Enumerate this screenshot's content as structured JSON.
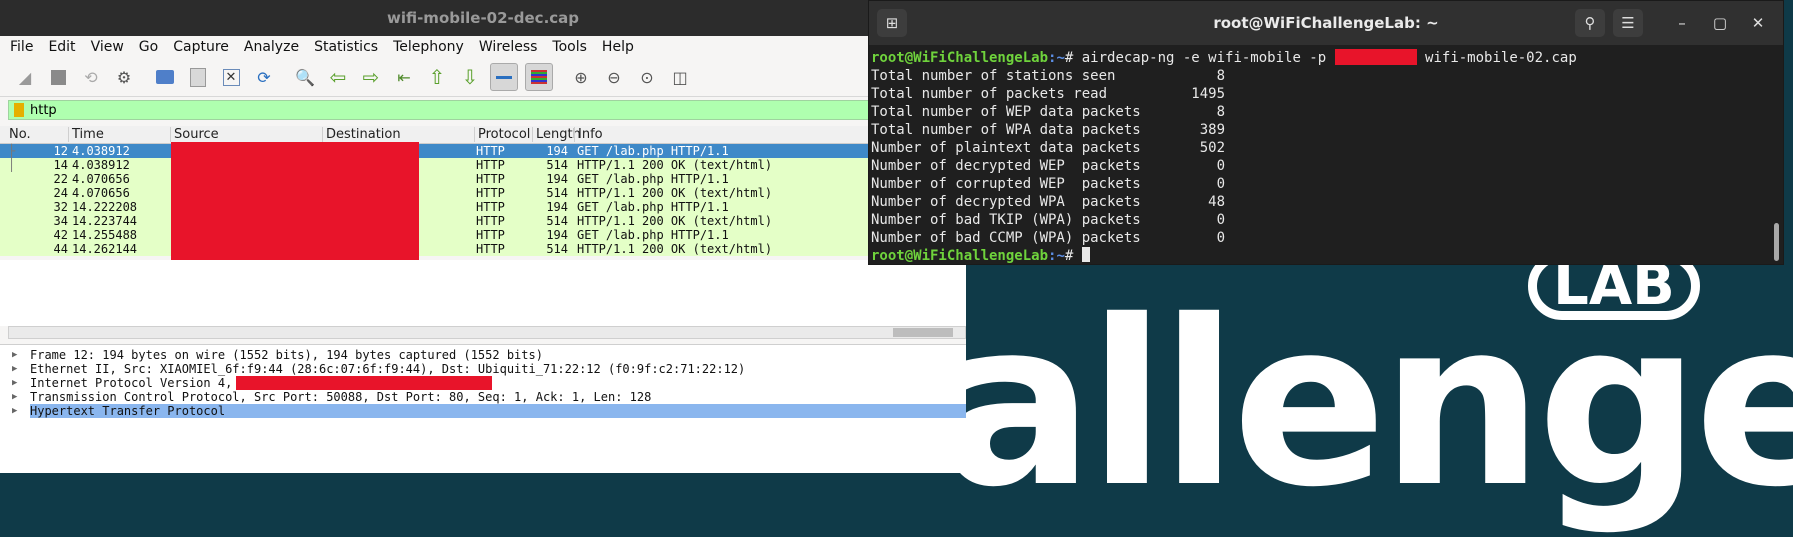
{
  "wireshark": {
    "window_title": "wifi-mobile-02-dec.cap",
    "menu": [
      "File",
      "Edit",
      "View",
      "Go",
      "Capture",
      "Analyze",
      "Statistics",
      "Telephony",
      "Wireless",
      "Tools",
      "Help"
    ],
    "filter_text": "http",
    "columns": [
      "No.",
      "Time",
      "Source",
      "Destination",
      "Protocol",
      "Length",
      "Info"
    ],
    "packets": [
      {
        "no": "12",
        "time": "4.038912",
        "protocol": "HTTP",
        "length": "194",
        "info": "GET /lab.php HTTP/1.1",
        "selected": true
      },
      {
        "no": "14",
        "time": "4.038912",
        "protocol": "HTTP",
        "length": "514",
        "info": "HTTP/1.1 200 OK  (text/html)"
      },
      {
        "no": "22",
        "time": "4.070656",
        "protocol": "HTTP",
        "length": "194",
        "info": "GET /lab.php HTTP/1.1"
      },
      {
        "no": "24",
        "time": "4.070656",
        "protocol": "HTTP",
        "length": "514",
        "info": "HTTP/1.1 200 OK  (text/html)"
      },
      {
        "no": "32",
        "time": "14.222208",
        "protocol": "HTTP",
        "length": "194",
        "info": "GET /lab.php HTTP/1.1"
      },
      {
        "no": "34",
        "time": "14.223744",
        "protocol": "HTTP",
        "length": "514",
        "info": "HTTP/1.1 200 OK  (text/html)"
      },
      {
        "no": "42",
        "time": "14.255488",
        "protocol": "HTTP",
        "length": "194",
        "info": "GET /lab.php HTTP/1.1"
      },
      {
        "no": "44",
        "time": "14.262144",
        "protocol": "HTTP",
        "length": "514",
        "info": "HTTP/1.1 200 OK  (text/html)"
      }
    ],
    "details": [
      "Frame 12: 194 bytes on wire (1552 bits), 194 bytes captured (1552 bits)",
      "Ethernet II, Src: XIAOMIEl_6f:f9:44 (28:6c:07:6f:f9:44), Dst: Ubiquiti_71:22:12 (f0:9f:c2:71:22:12)",
      "Internet Protocol Version 4,",
      "Transmission Control Protocol, Src Port: 50088, Dst Port: 80, Seq: 1, Ack: 1, Len: 128",
      "Hypertext Transfer Protocol"
    ]
  },
  "terminal": {
    "title": "root@WiFiChallengeLab: ~",
    "prompt_user": "root@WiFiChallengeLab",
    "prompt_path": ":~",
    "prompt_symbol": "# ",
    "command_before": "airdecap-ng -e wifi-mobile -p ",
    "command_after": " wifi-mobile-02.cap",
    "output": [
      "Total number of stations seen            8",
      "Total number of packets read          1495",
      "Total number of WEP data packets         8",
      "Total number of WPA data packets       389",
      "Number of plaintext data packets       502",
      "Number of decrypted WEP  packets         0",
      "Number of corrupted WEP  packets         0",
      "Number of decrypted WPA  packets        48",
      "Number of bad TKIP (WPA) packets         0",
      "Number of bad CCMP (WPA) packets         0"
    ]
  },
  "background": {
    "badge": "LAB",
    "word": "allenge"
  },
  "colors": {
    "filter_ok": "#afffaf",
    "http_row": "#e4ffc7",
    "selected_row": "#3e89c8",
    "redaction": "#e8142a",
    "prompt_user": "#6fd33c",
    "prompt_path": "#5c8fe6"
  }
}
